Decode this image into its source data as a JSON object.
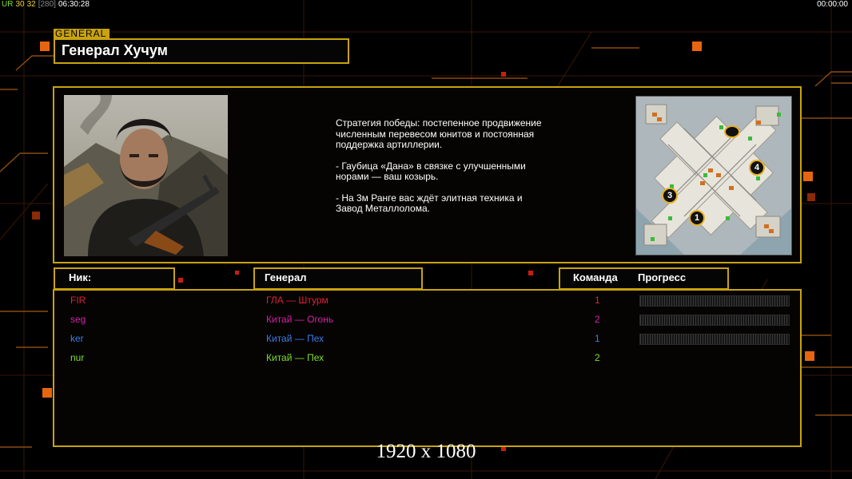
{
  "hud": {
    "ur_label": "UR",
    "value_a": "30",
    "value_b": "32",
    "value_c": "[280]",
    "clock": "06:30:28",
    "timer": "00:00:00"
  },
  "general_tag": "GENERAL",
  "general_name": "Генерал Хучум",
  "strategy": [
    "Стратегия победы: постепенное продвижение численным перевесом юнитов и постоянная поддержка артиллерии.",
    "- Гаубица «Дана» в связке с улучшенными норами — ваш козырь.",
    "- На 3м Ранге вас ждёт элитная техника и Завод Металлолома."
  ],
  "headers": {
    "nick": "Ник:",
    "general": "Генерал",
    "team": "Команда",
    "progress": "Прогресс"
  },
  "players": [
    {
      "nick": "FIR",
      "general": "ГЛА — Штурм",
      "team": "1",
      "color": "#e0203a",
      "progress": 0
    },
    {
      "nick": "seg",
      "general": "Китай — Огонь",
      "team": "2",
      "color": "#d81fa8",
      "progress": 0
    },
    {
      "nick": "ker",
      "general": "Китай — Пех",
      "team": "1",
      "color": "#3a7de8",
      "progress": 0
    },
    {
      "nick": "nur",
      "general": "Китай — Пех",
      "team": "2",
      "color": "#7de02a",
      "progress": 0
    }
  ],
  "map_markers": [
    "1",
    "3",
    "4"
  ],
  "resolution_label": "1920 x 1080",
  "colors": {
    "accent": "#c9a30e",
    "background": "#000000",
    "ur": "#7de02a",
    "hud_yellow": "#e8d040"
  }
}
